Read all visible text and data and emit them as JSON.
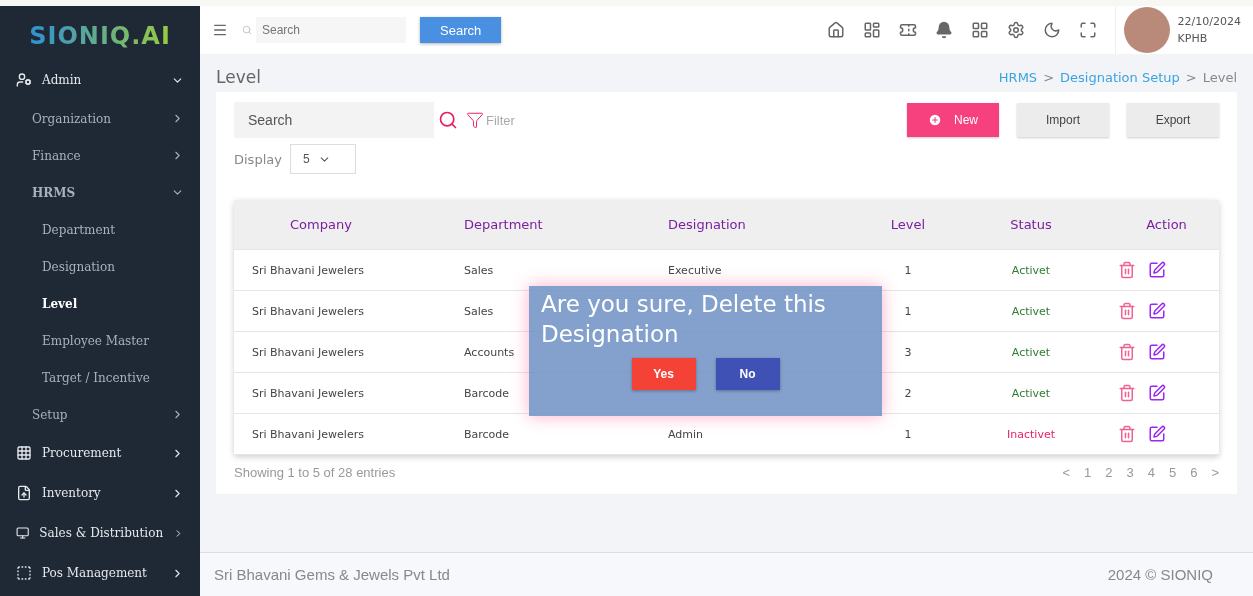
{
  "logo": "SIONIQ.AI",
  "top_search": {
    "placeholder": "Search",
    "button": "Search"
  },
  "user": {
    "date": "22/10/2024",
    "branch": "KPHB"
  },
  "sidebar": {
    "items": [
      {
        "label": "Admin",
        "expanded": true,
        "children": [
          {
            "label": "Organization",
            "expanded": false,
            "selected": false
          },
          {
            "label": "Finance",
            "expanded": false,
            "selected": false
          },
          {
            "label": "HRMS",
            "expanded": true,
            "selected": false,
            "children": [
              {
                "label": "Department",
                "selected": false
              },
              {
                "label": "Designation",
                "selected": false
              },
              {
                "label": "Level",
                "selected": true
              },
              {
                "label": "Employee Master",
                "selected": false
              },
              {
                "label": "Target / Incentive",
                "selected": false
              }
            ]
          },
          {
            "label": "Setup",
            "expanded": false,
            "selected": false
          }
        ]
      },
      {
        "label": "Procurement",
        "expanded": false
      },
      {
        "label": "Inventory",
        "expanded": false
      },
      {
        "label": "Sales & Distribution",
        "expanded": false
      },
      {
        "label": "Pos Management",
        "expanded": false
      }
    ]
  },
  "page_title": "Level",
  "breadcrumb": {
    "separator": ">",
    "items": [
      {
        "label": "HRMS",
        "link": true
      },
      {
        "label": "Designation Setup",
        "link": true
      },
      {
        "label": "Level",
        "link": false
      }
    ]
  },
  "toolbar": {
    "search_placeholder": "Search",
    "filter": "Filter",
    "display_label": "Display",
    "display_value": "5",
    "buttons": [
      {
        "label": "New",
        "kind": "primary"
      },
      {
        "label": "Import",
        "kind": "plain"
      },
      {
        "label": "Export",
        "kind": "plain"
      }
    ]
  },
  "table": {
    "columns": [
      "Company",
      "Department",
      "Designation",
      "Level",
      "Status",
      "Action"
    ],
    "rows": [
      {
        "company": "Sri Bhavani Jewelers",
        "department": "Sales",
        "designation": "Executive",
        "level": "1",
        "status": "Activet",
        "active": true
      },
      {
        "company": "Sri Bhavani Jewelers",
        "department": "Sales",
        "level": "1",
        "status": "Activet",
        "active": true
      },
      {
        "company": "Sri Bhavani Jewelers",
        "department": "Accounts",
        "level": "3",
        "status": "Activet",
        "active": true
      },
      {
        "company": "Sri Bhavani Jewelers",
        "department": "Barcode",
        "level": "2",
        "status": "Activet",
        "active": true
      },
      {
        "company": "Sri Bhavani Jewelers",
        "department": "Barcode",
        "designation": "Admin",
        "level": "1",
        "status": "Inactivet",
        "active": false
      }
    ]
  },
  "entries": "Showing 1 to 5 of 28 entries",
  "pagination": {
    "prev": "<",
    "pages": [
      "1",
      "2",
      "3",
      "4",
      "5",
      "6"
    ],
    "next": ">"
  },
  "dialog": {
    "message": "Are you sure, Delete this Designation",
    "buttons": [
      {
        "label": "Yes",
        "kind": "confirm"
      },
      {
        "label": "No",
        "kind": "cancel"
      }
    ]
  },
  "footer": {
    "company": "Sri Bhavani Gems & Jewels Pvt Ltd",
    "copyright": "2024 © SIONIQ"
  }
}
